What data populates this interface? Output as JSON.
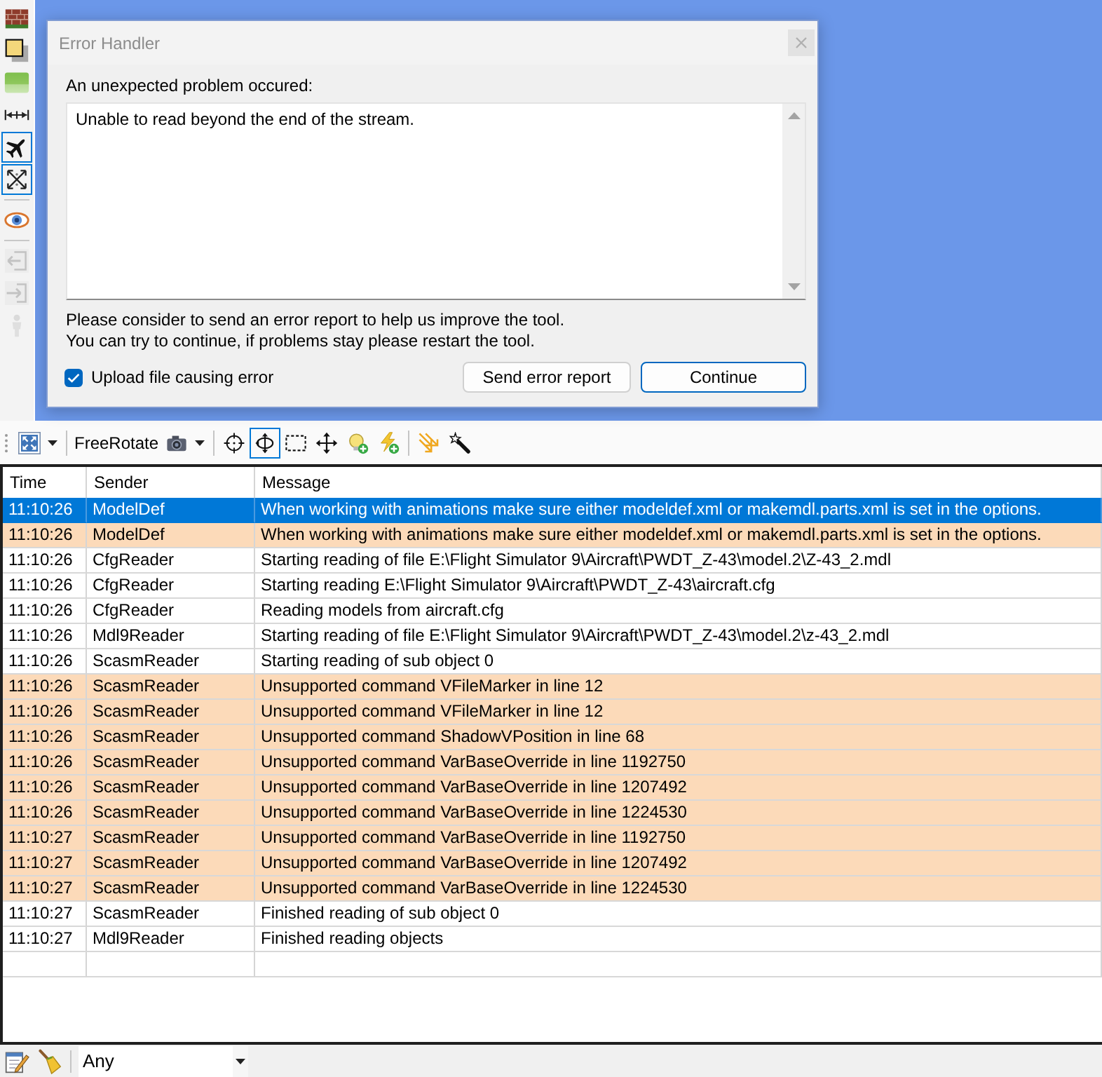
{
  "left_toolbar": {
    "groups": [
      [
        {
          "kind": "brick-wall",
          "selected": false,
          "disabled": false
        },
        {
          "kind": "square",
          "selected": false,
          "disabled": false
        },
        {
          "kind": "gradient-tile",
          "selected": false,
          "disabled": false
        },
        {
          "kind": "dimension-line",
          "selected": false,
          "disabled": false
        },
        {
          "kind": "airplane",
          "selected": true,
          "disabled": false
        },
        {
          "kind": "crossed-arrows",
          "selected": true,
          "disabled": false
        }
      ],
      [
        {
          "kind": "eye",
          "selected": false,
          "disabled": false
        }
      ],
      [
        {
          "kind": "exit-arrow",
          "selected": false,
          "disabled": true
        },
        {
          "kind": "enter-arrow",
          "selected": false,
          "disabled": true
        },
        {
          "kind": "figure",
          "selected": false,
          "disabled": true
        }
      ]
    ]
  },
  "error_dialog": {
    "title": "Error Handler",
    "heading": "An unexpected problem occured:",
    "details": "Unable to read beyond the end of the stream.",
    "notes": [
      "Please consider to send an error report to help us improve the tool.",
      "You can try to continue, if problems stay please restart the tool."
    ],
    "upload_checkbox": {
      "label": "Upload file causing error",
      "checked": true
    },
    "buttons": [
      {
        "label": "Send error report",
        "default": false
      },
      {
        "label": "Continue",
        "default": true
      }
    ]
  },
  "main_toolbar": {
    "groups": [
      [
        {
          "kind": "expand-arrows",
          "dropdown": true,
          "selected": false
        }
      ],
      [
        {
          "kind": "text",
          "label": "FreeRotate",
          "dropdown": false,
          "selected": false
        },
        {
          "kind": "camera",
          "dropdown": true,
          "selected": false
        }
      ],
      [
        {
          "kind": "crosshair",
          "dropdown": false,
          "selected": false
        },
        {
          "kind": "rotate-arrows",
          "dropdown": false,
          "selected": true
        },
        {
          "kind": "selection-rectangle",
          "dropdown": false,
          "selected": false
        },
        {
          "kind": "move-arrows",
          "dropdown": false,
          "selected": false
        },
        {
          "kind": "lightbulb-add",
          "dropdown": false,
          "selected": false
        },
        {
          "kind": "lightning-add",
          "dropdown": false,
          "selected": false
        }
      ],
      [
        {
          "kind": "diagonal-arrows",
          "dropdown": false,
          "selected": false
        },
        {
          "kind": "wand",
          "dropdown": false,
          "selected": false
        }
      ]
    ]
  },
  "log_table": {
    "columns": [
      "Time",
      "Sender",
      "Message"
    ],
    "rows": [
      {
        "time": "11:10:26",
        "sender": "ModelDef",
        "message": "When working with animations make sure either modeldef.xml or makemdl.parts.xml is set in the options.",
        "selected": true
      },
      {
        "time": "11:10:26",
        "sender": "ModelDef",
        "message": "When working with animations make sure either modeldef.xml or makemdl.parts.xml is set in the options.",
        "kind": "warning",
        "selected": false
      },
      {
        "time": "11:10:26",
        "sender": "CfgReader",
        "message": "Starting reading of file E:\\Flight Simulator 9\\Aircraft\\PWDT_Z-43\\model.2\\Z-43_2.mdl",
        "kind": "info",
        "selected": false
      },
      {
        "time": "11:10:26",
        "sender": "CfgReader",
        "message": "Starting reading E:\\Flight Simulator 9\\Aircraft\\PWDT_Z-43\\aircraft.cfg",
        "kind": "info",
        "selected": false
      },
      {
        "time": "11:10:26",
        "sender": "CfgReader",
        "message": "Reading models from aircraft.cfg",
        "kind": "info",
        "selected": false
      },
      {
        "time": "11:10:26",
        "sender": "Mdl9Reader",
        "message": "Starting reading of file E:\\Flight Simulator 9\\Aircraft\\PWDT_Z-43\\model.2\\z-43_2.mdl",
        "kind": "info",
        "selected": false
      },
      {
        "time": "11:10:26",
        "sender": "ScasmReader",
        "message": "Starting reading of sub object 0",
        "kind": "info",
        "selected": false
      },
      {
        "time": "11:10:26",
        "sender": "ScasmReader",
        "message": "Unsupported command VFileMarker in line 12",
        "kind": "warning",
        "selected": false
      },
      {
        "time": "11:10:26",
        "sender": "ScasmReader",
        "message": "Unsupported command VFileMarker in line 12",
        "kind": "warning",
        "selected": false
      },
      {
        "time": "11:10:26",
        "sender": "ScasmReader",
        "message": "Unsupported command ShadowVPosition in line 68",
        "kind": "warning",
        "selected": false
      },
      {
        "time": "11:10:26",
        "sender": "ScasmReader",
        "message": "Unsupported command VarBaseOverride in line 1192750",
        "kind": "warning",
        "selected": false
      },
      {
        "time": "11:10:26",
        "sender": "ScasmReader",
        "message": "Unsupported command VarBaseOverride in line 1207492",
        "kind": "warning",
        "selected": false
      },
      {
        "time": "11:10:26",
        "sender": "ScasmReader",
        "message": "Unsupported command VarBaseOverride in line 1224530",
        "kind": "warning",
        "selected": false
      },
      {
        "time": "11:10:27",
        "sender": "ScasmReader",
        "message": "Unsupported command VarBaseOverride in line 1192750",
        "kind": "warning",
        "selected": false
      },
      {
        "time": "11:10:27",
        "sender": "ScasmReader",
        "message": "Unsupported command VarBaseOverride in line 1207492",
        "kind": "warning",
        "selected": false
      },
      {
        "time": "11:10:27",
        "sender": "ScasmReader",
        "message": "Unsupported command VarBaseOverride in line 1224530",
        "kind": "warning",
        "selected": false
      },
      {
        "time": "11:10:27",
        "sender": "ScasmReader",
        "message": "Finished reading of sub object 0",
        "kind": "info",
        "selected": false
      },
      {
        "time": "11:10:27",
        "sender": "Mdl9Reader",
        "message": "Finished reading objects",
        "kind": "info",
        "selected": false
      }
    ]
  },
  "bottom_bar": {
    "tools": [
      {
        "kind": "notepad"
      },
      {
        "kind": "broom"
      }
    ],
    "filter": {
      "value": "Any"
    }
  }
}
